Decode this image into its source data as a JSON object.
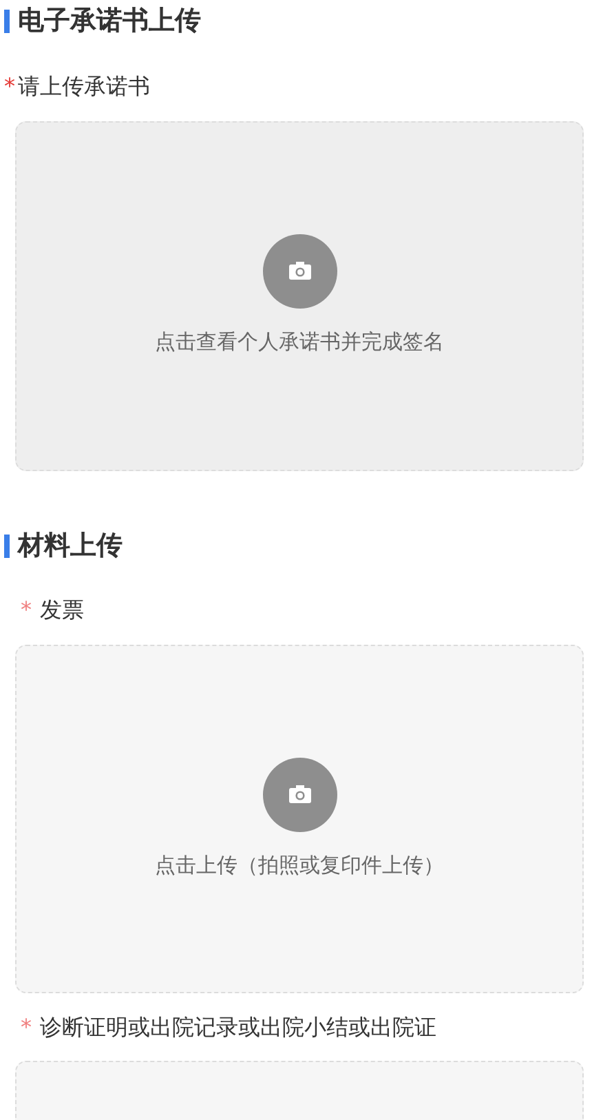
{
  "sections": [
    {
      "title": "电子承诺书上传",
      "fields": [
        {
          "kind": "signature",
          "required_mark": "*",
          "label": "请上传承诺书",
          "hint": "点击查看个人承诺书并完成签名"
        }
      ]
    },
    {
      "title": "材料上传",
      "fields": [
        {
          "kind": "photo",
          "required_mark": "*",
          "label": "发票",
          "hint": "点击上传（拍照或复印件上传）"
        },
        {
          "kind": "photo",
          "required_mark": "*",
          "label": "诊断证明或出院记录或出院小结或出院证"
        }
      ]
    }
  ]
}
